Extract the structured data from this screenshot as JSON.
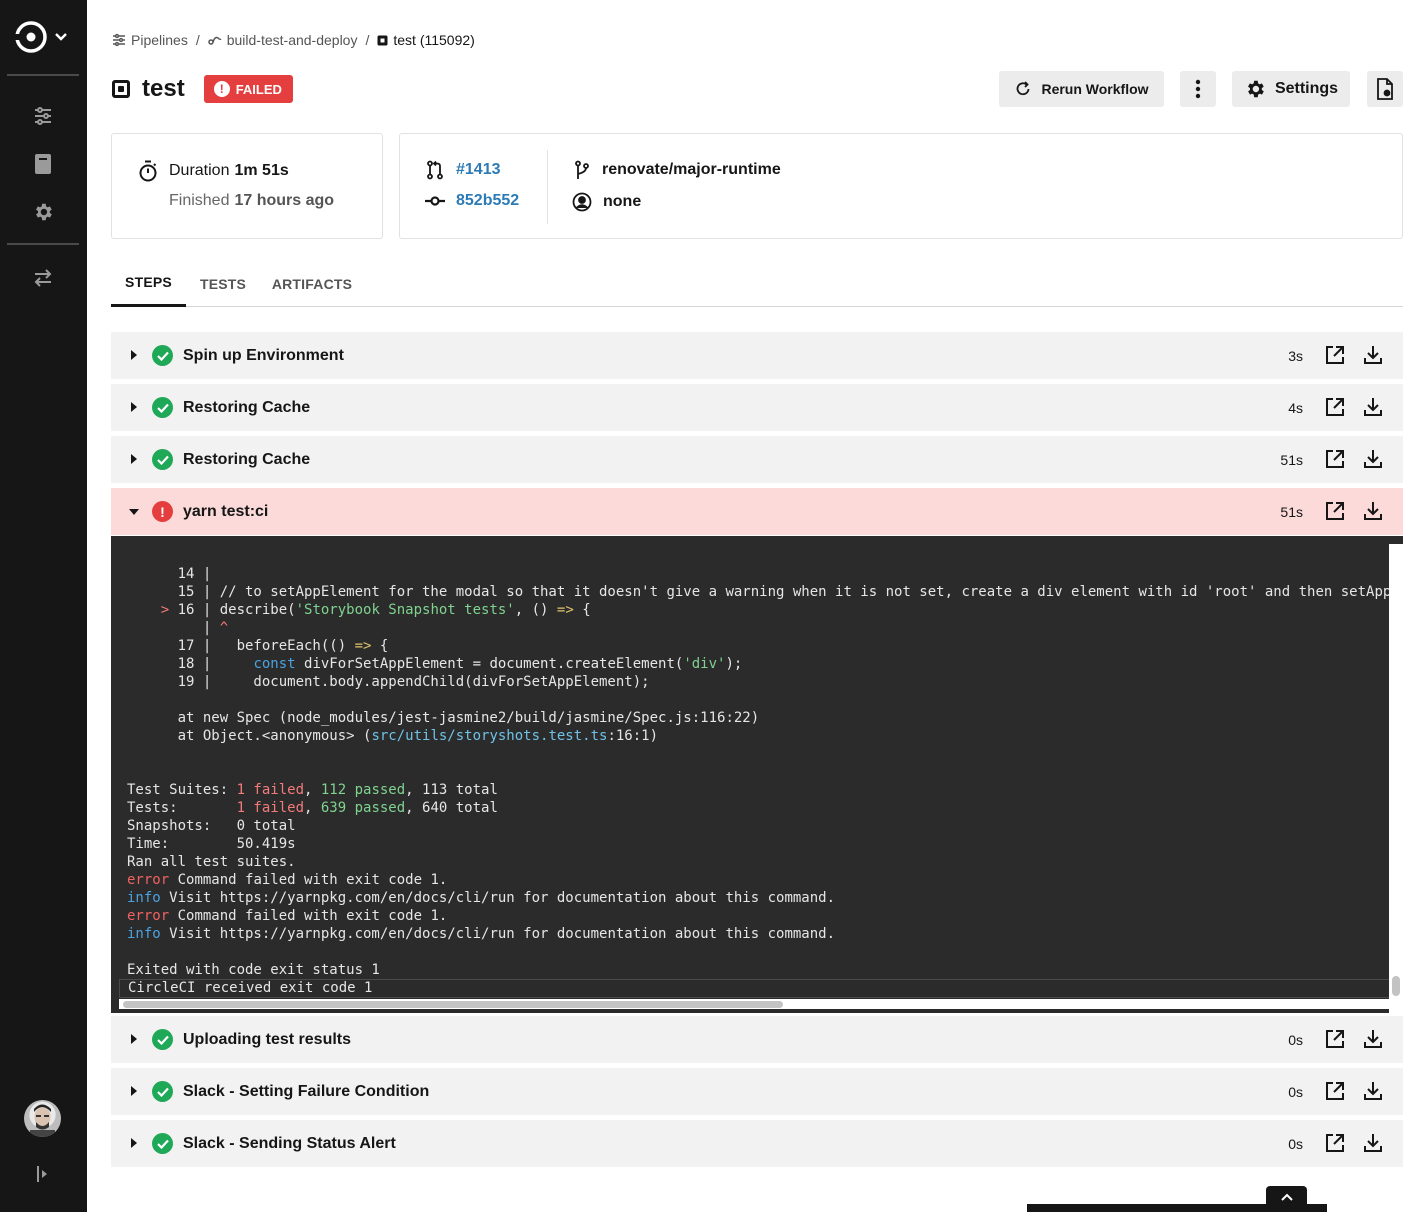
{
  "breadcrumb": {
    "pipelines": "Pipelines",
    "sep1": "/",
    "workflow": "build-test-and-deploy",
    "sep2": "/",
    "job": "test (115092)"
  },
  "header": {
    "title": "test",
    "status": "FAILED",
    "rerun_label": "Rerun Workflow",
    "settings_label": "Settings"
  },
  "summary": {
    "duration_label": "Duration",
    "duration_value": "1m 51s",
    "finished_label": "Finished",
    "finished_value": "17 hours ago",
    "pr": "#1413",
    "commit": "852b552",
    "branch": "renovate/major-runtime",
    "author": "none"
  },
  "tabs": [
    {
      "label": "STEPS",
      "active": true
    },
    {
      "label": "TESTS",
      "active": false
    },
    {
      "label": "ARTIFACTS",
      "active": false
    }
  ],
  "steps": [
    {
      "name": "Spin up Environment",
      "duration": "3s",
      "status": "success"
    },
    {
      "name": "Restoring Cache",
      "duration": "4s",
      "status": "success"
    },
    {
      "name": "Restoring Cache",
      "duration": "51s",
      "status": "success"
    },
    {
      "name": "yarn test:ci",
      "duration": "51s",
      "status": "failed"
    },
    {
      "name": "Uploading test results",
      "duration": "0s",
      "status": "success"
    },
    {
      "name": "Slack - Setting Failure Condition",
      "duration": "0s",
      "status": "success"
    },
    {
      "name": "Slack - Sending Status Alert",
      "duration": "0s",
      "status": "success"
    }
  ],
  "log": {
    "lines": [
      "      14 |",
      "      15 | // to setAppElement for the modal so that it doesn't give a warning when it is not set, create a div element with id 'root' and then setApp",
      "    > 16 | describe('Storybook Snapshot tests', () => {",
      "         | ^",
      "      17 |   beforeEach(() => {",
      "      18 |     const divForSetAppElement = document.createElement('div');",
      "      19 |     document.body.appendChild(divForSetAppElement);",
      "",
      "      at new Spec (node_modules/jest-jasmine2/build/jasmine/Spec.js:116:22)",
      "      at Object.<anonymous> (src/utils/storyshots.test.ts:16:1)",
      "",
      "",
      "Test Suites: 1 failed, 112 passed, 113 total",
      "Tests:       1 failed, 639 passed, 640 total",
      "Snapshots:   0 total",
      "Time:        50.419s",
      "Ran all test suites.",
      "error Command failed with exit code 1.",
      "info Visit https://yarnpkg.com/en/docs/cli/run for documentation about this command.",
      "error Command failed with exit code 1.",
      "info Visit https://yarnpkg.com/en/docs/cli/run for documentation about this command.",
      "",
      "Exited with code exit status 1"
    ],
    "status_line": "CircleCI received exit code 1"
  },
  "colors": {
    "failed": "#e53e3e",
    "success": "#1fa857",
    "link": "#2c7bb6",
    "sidebar": "#161616",
    "failed_row": "#fcdada"
  },
  "icons": {
    "sidebar": [
      "circleci-logo-icon",
      "pipelines-icon",
      "insights-icon",
      "settings-icon",
      "switch-org-icon",
      "collapse-sidebar-icon"
    ],
    "actions": [
      "open-in-new-icon",
      "download-icon"
    ]
  }
}
